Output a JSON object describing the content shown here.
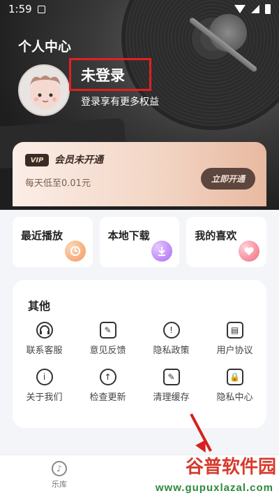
{
  "status_bar": {
    "time": "1:59",
    "notif_icon": "A"
  },
  "header": {
    "title": "个人中心"
  },
  "profile": {
    "name": "未登录",
    "subtitle": "登录享有更多权益"
  },
  "vip": {
    "badge": "VIP",
    "title": "会员未开通",
    "price_text": "每天低至0.01元",
    "button_label": "立即开通"
  },
  "quick": [
    {
      "label": "最近播放",
      "icon": "clock-icon"
    },
    {
      "label": "本地下载",
      "icon": "download-icon"
    },
    {
      "label": "我的喜欢",
      "icon": "heart-icon"
    }
  ],
  "other": {
    "title": "其他",
    "items": [
      {
        "label": "联系客服",
        "icon": "headset-icon"
      },
      {
        "label": "意见反馈",
        "icon": "edit-icon"
      },
      {
        "label": "隐私政策",
        "icon": "shield-icon"
      },
      {
        "label": "用户协议",
        "icon": "document-icon"
      },
      {
        "label": "关于我们",
        "icon": "info-icon"
      },
      {
        "label": "检查更新",
        "icon": "upload-cloud-icon"
      },
      {
        "label": "清理缓存",
        "icon": "edit-icon"
      },
      {
        "label": "隐私中心",
        "icon": "lock-icon"
      }
    ]
  },
  "nav": {
    "library_label": "乐库"
  },
  "watermark": {
    "text": "谷普软件园",
    "url": "www.gupuxlazal.com"
  },
  "colors": {
    "accent_red": "#e12020",
    "vip_button": "#5c463e"
  }
}
